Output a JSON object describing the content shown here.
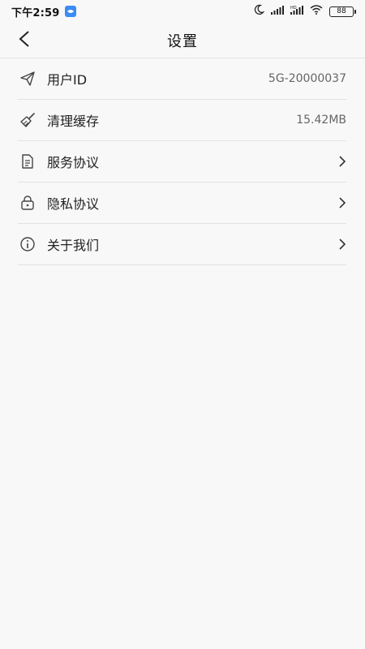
{
  "status_bar": {
    "time": "下午2:59",
    "battery": "88"
  },
  "header": {
    "title": "设置"
  },
  "settings": {
    "items": [
      {
        "label": "用户ID",
        "value": "5G-20000037",
        "icon": "paper-plane-icon"
      },
      {
        "label": "清理缓存",
        "value": "15.42MB",
        "icon": "broom-icon"
      },
      {
        "label": "服务协议",
        "icon": "document-icon",
        "chevron": true
      },
      {
        "label": "隐私协议",
        "icon": "lock-icon",
        "chevron": true
      },
      {
        "label": "关于我们",
        "icon": "info-icon",
        "chevron": true
      }
    ]
  }
}
